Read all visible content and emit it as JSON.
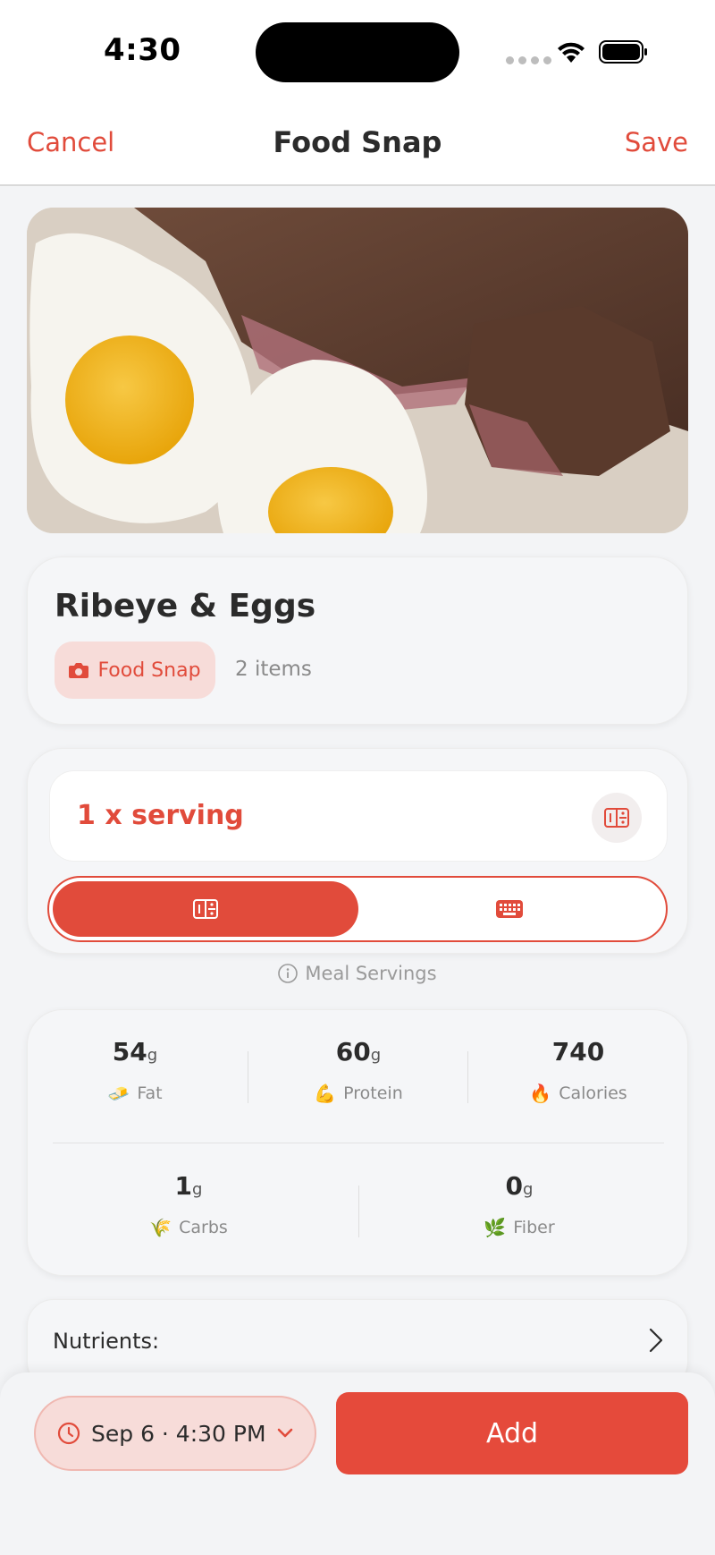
{
  "status_bar": {
    "time": "4:30"
  },
  "nav": {
    "cancel_label": "Cancel",
    "title": "Food Snap",
    "save_label": "Save"
  },
  "meal": {
    "name": "Ribeye & Eggs",
    "source_label": "Food Snap",
    "item_count": "2 items"
  },
  "serving": {
    "text": "1 x serving",
    "hint": "Meal Servings",
    "mode_selected": "fraction"
  },
  "macros": [
    {
      "value": "54",
      "unit": "g",
      "label": "Fat",
      "icon": "butter-emoji"
    },
    {
      "value": "60",
      "unit": "g",
      "label": "Protein",
      "icon": "flexed-biceps-emoji"
    },
    {
      "value": "740",
      "unit": "",
      "label": "Calories",
      "icon": "fire-emoji"
    },
    {
      "value": "1",
      "unit": "g",
      "label": "Carbs",
      "icon": "wheat-emoji"
    },
    {
      "value": "0",
      "unit": "g",
      "label": "Fiber",
      "icon": "leaf-emoji"
    }
  ],
  "nutrients": {
    "label": "Nutrients:"
  },
  "bottom": {
    "date_label": "Sep 6 · 4:30 PM",
    "add_label": "Add"
  },
  "colors": {
    "accent": "#e14b3b",
    "accent_light": "#f7dcd9",
    "background": "#f3f4f6"
  }
}
